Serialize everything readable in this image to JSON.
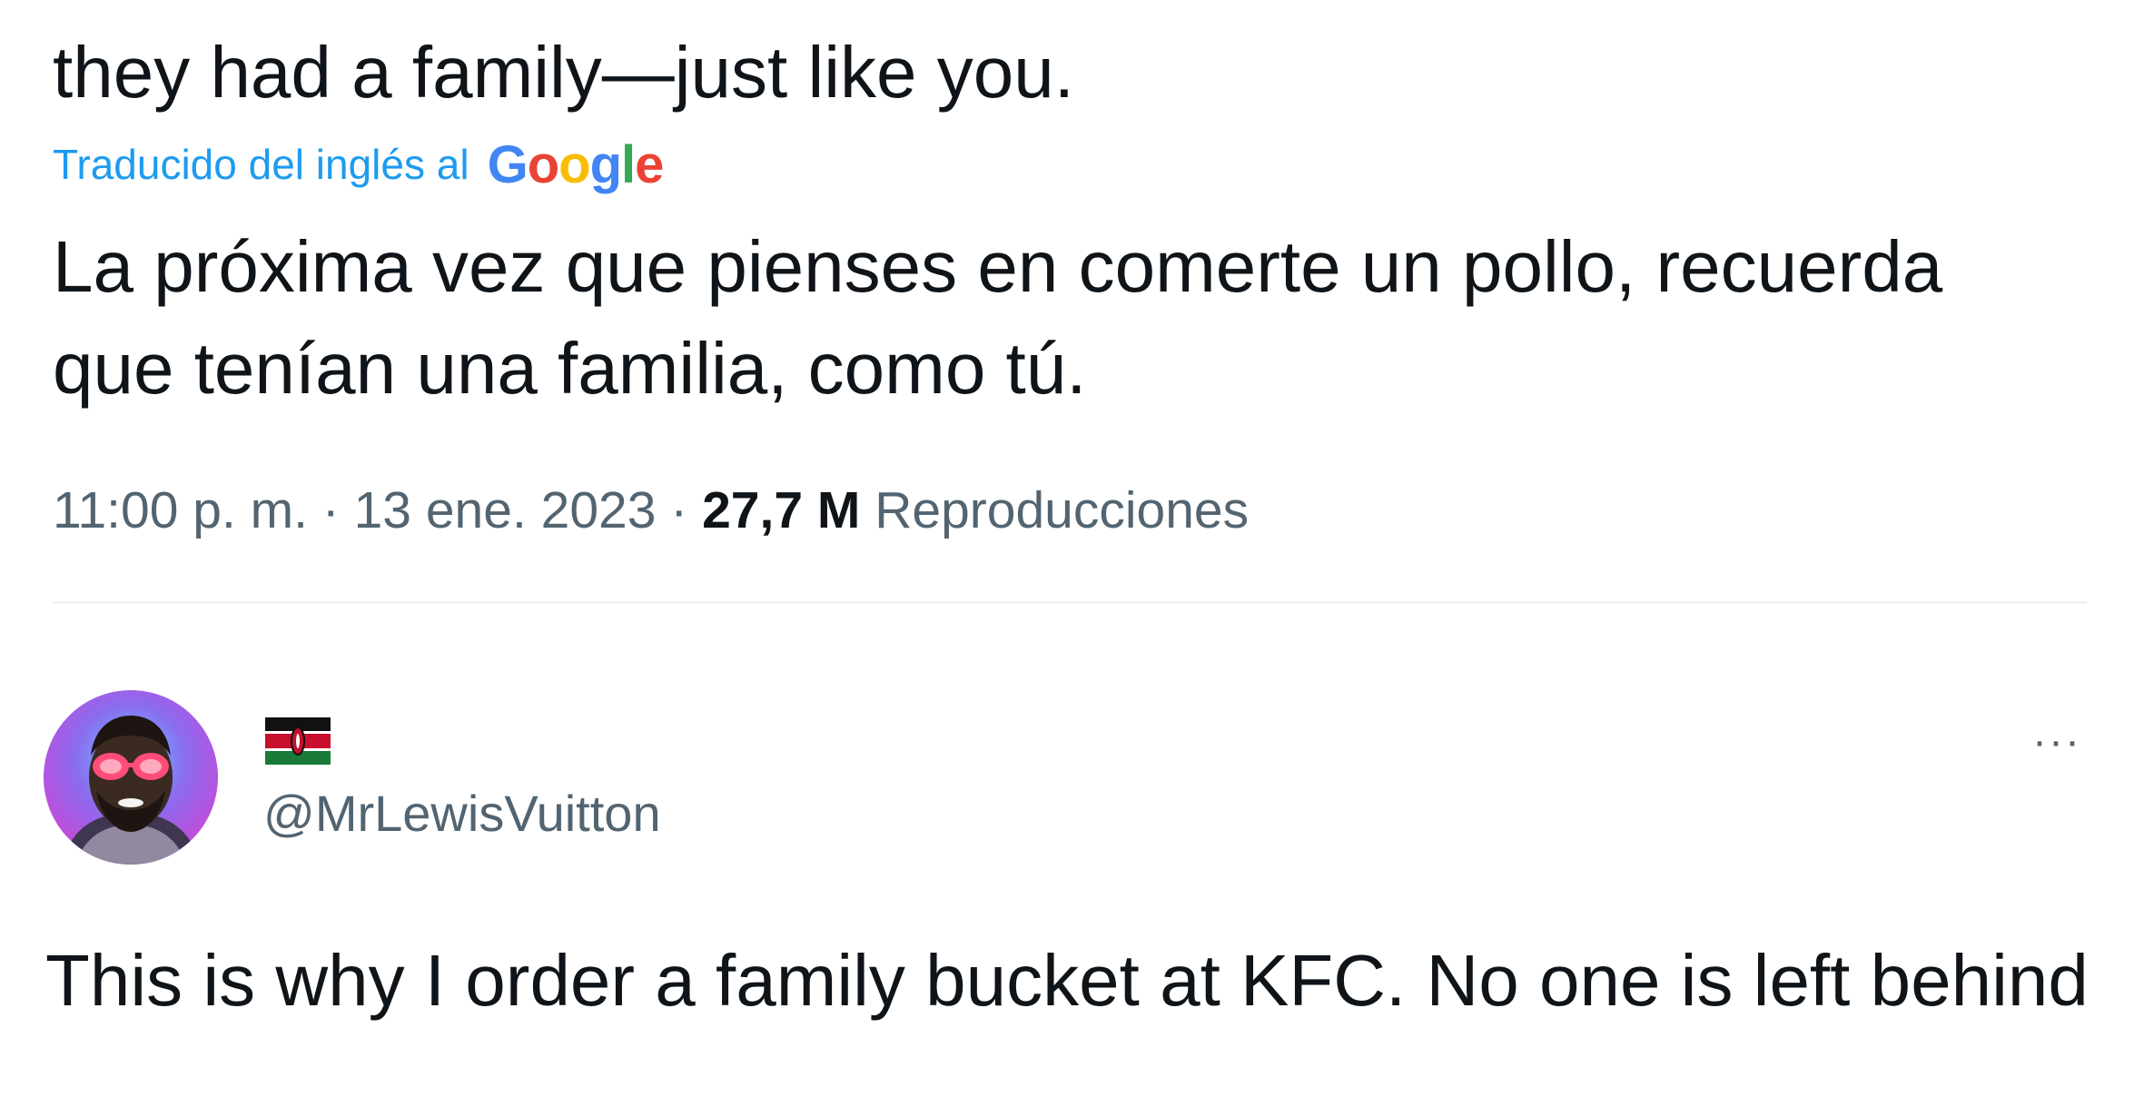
{
  "tweet": {
    "original_text_last_line": "they had a family—just like you.",
    "translated_label": "Traducido del inglés al",
    "translator_brand": [
      "G",
      "o",
      "o",
      "g",
      "l",
      "e"
    ],
    "translated_text": "La próxima vez que pienses en comerte un pollo, recuerda que tenían una familia, como tú.",
    "time": "11:00 p. m.",
    "separator": "·",
    "date": "13 ene. 2023",
    "views_count": "27,7 M",
    "views_label": "Reproducciones"
  },
  "reply": {
    "display_name_emoji": "kenya-flag-icon",
    "handle": "@MrLewisVuitton",
    "more_label": "···",
    "text": "This is why I order a family bucket at KFC. No one is left behind"
  },
  "colors": {
    "link_blue": "#1d9bf0",
    "secondary_text": "#536471",
    "primary_text": "#0f1419",
    "divider": "#eff3f4"
  }
}
